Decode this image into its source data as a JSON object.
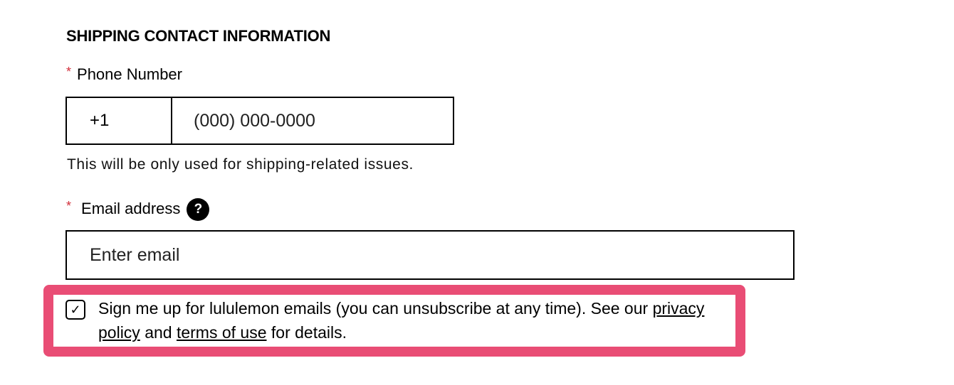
{
  "section": {
    "title": "SHIPPING CONTACT INFORMATION"
  },
  "phone": {
    "required_mark": "*",
    "label": "Phone Number",
    "country_code": "+1",
    "placeholder": "(000) 000-0000",
    "value": "",
    "hint": "This will be only used for shipping-related issues."
  },
  "email": {
    "required_mark": "*",
    "label": "Email address",
    "help_icon": "question-mark-icon",
    "help_glyph": "?",
    "placeholder": "Enter email",
    "value": ""
  },
  "optin": {
    "checked": true,
    "check_glyph": "✓",
    "text_before": "Sign me up for lululemon emails (you can unsubscribe at any time). See our",
    "privacy_link": "privacy policy",
    "and": "and",
    "terms_link": "terms of use",
    "text_after": "for details."
  },
  "colors": {
    "required": "#d22e3a",
    "highlight": "#e94d75"
  }
}
